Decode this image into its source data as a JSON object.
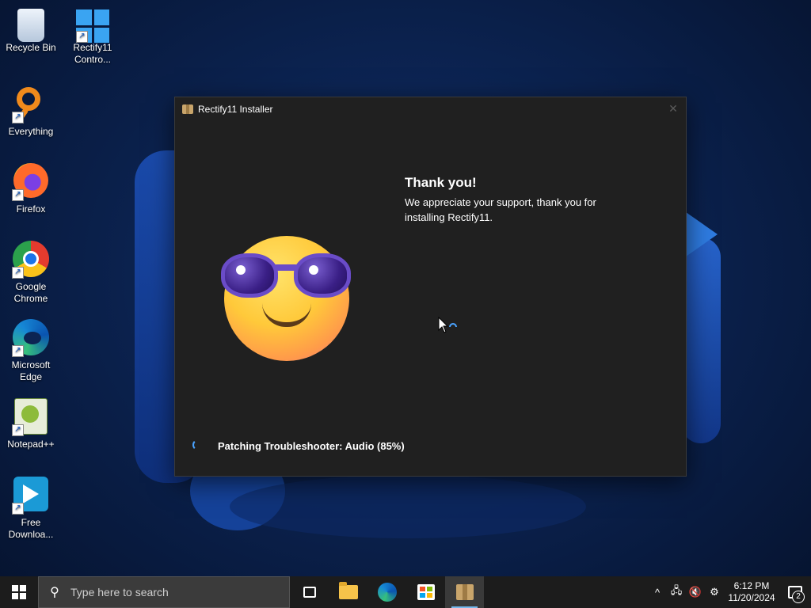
{
  "desktop": {
    "icons": [
      {
        "label": "Recycle Bin",
        "icon": "recycle-bin-icon"
      },
      {
        "label": "Rectify11 Contro...",
        "icon": "rectify11-control-panel-icon"
      },
      {
        "label": "Everything",
        "icon": "everything-search-icon"
      },
      {
        "label": "Firefox",
        "icon": "firefox-icon"
      },
      {
        "label": "Google Chrome",
        "icon": "chrome-icon"
      },
      {
        "label": "Microsoft Edge",
        "icon": "edge-icon"
      },
      {
        "label": "Notepad++",
        "icon": "notepad-plus-plus-icon"
      },
      {
        "label": "Free Downloa...",
        "icon": "free-download-manager-icon"
      }
    ]
  },
  "installer": {
    "title": "Rectify11 Installer",
    "close_glyph": "✕",
    "heading": "Thank you!",
    "message": "We appreciate your support, thank you for installing Rectify11.",
    "status": "Patching Troubleshooter: Audio (85%)",
    "progress_percent": 85,
    "accent_color": "#4aa3ff"
  },
  "taskbar": {
    "search_placeholder": "Type here to search",
    "search_glyph": "⚲",
    "apps": [
      "task-view-icon",
      "file-explorer-icon",
      "edge-icon",
      "microsoft-store-icon",
      "rectify11-installer-icon"
    ],
    "tray": {
      "chevron": "^",
      "network": "🖧",
      "volume": "🔇",
      "settings": "⚙"
    },
    "clock_time": "6:12 PM",
    "clock_date": "11/20/2024",
    "notification_count": "2"
  }
}
